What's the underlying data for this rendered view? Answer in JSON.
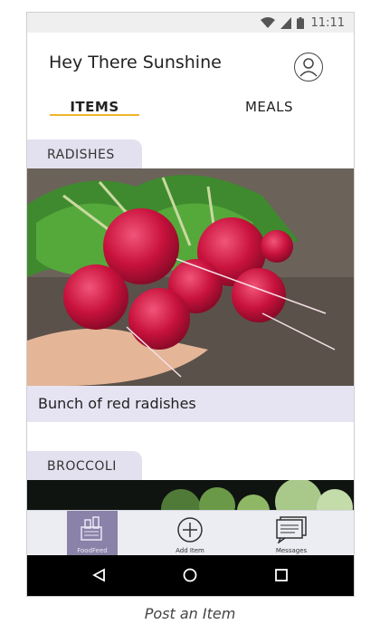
{
  "status_bar": {
    "time": "11:11"
  },
  "header": {
    "greeting": "Hey There Sunshine"
  },
  "tabs": [
    {
      "label": "ITEMS",
      "active": true
    },
    {
      "label": "MEALS",
      "active": false
    }
  ],
  "feed": {
    "cards": [
      {
        "category": "RADISHES",
        "caption": "Bunch of red radishes"
      },
      {
        "category": "BROCCOLI",
        "caption": ""
      }
    ]
  },
  "bottom_nav": {
    "items": [
      {
        "label": "FoodFeed",
        "icon": "food-basket-icon",
        "active": true
      },
      {
        "label": "Add Item",
        "icon": "plus-circle-icon",
        "active": false
      },
      {
        "label": "Messages",
        "icon": "messages-icon",
        "active": false
      }
    ]
  },
  "system_nav": {
    "icons": [
      "back-icon",
      "home-icon",
      "recents-icon"
    ]
  },
  "figure_caption": "Post an Item",
  "colors": {
    "accent_underline": "#f0b429",
    "label_bg": "#e3e1ef",
    "nav_active_bg": "#8a82a8"
  }
}
